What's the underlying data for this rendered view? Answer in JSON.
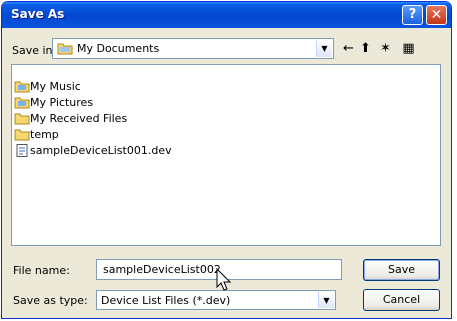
{
  "window": {
    "title": "Save As"
  },
  "title_buttons": {
    "help": "?",
    "close": "✕"
  },
  "save_in": {
    "label": "Save in:",
    "value": "My Documents",
    "folder_icon": "folder-icon"
  },
  "toolbar": [
    {
      "name": "back-icon",
      "glyph": "←"
    },
    {
      "name": "up-folder-icon",
      "glyph": "⬆"
    },
    {
      "name": "new-folder-icon",
      "glyph": "✶"
    },
    {
      "name": "view-menu-icon",
      "glyph": "▦"
    }
  ],
  "files": [
    {
      "label": "My Music",
      "kind": "special-folder",
      "icon": "music-folder-icon"
    },
    {
      "label": "My Pictures",
      "kind": "special-folder",
      "icon": "pictures-folder-icon"
    },
    {
      "label": "My Received Files",
      "kind": "folder",
      "icon": "folder-icon"
    },
    {
      "label": "temp",
      "kind": "folder",
      "icon": "folder-icon"
    },
    {
      "label": "sampleDeviceList001.dev",
      "kind": "file",
      "icon": "document-icon"
    }
  ],
  "file_name": {
    "label": "File name:",
    "value": "sampleDeviceList002"
  },
  "save_as_type": {
    "label": "Save as type:",
    "value": "Device List Files (*.dev)"
  },
  "buttons": {
    "save": "Save",
    "cancel": "Cancel"
  },
  "colors": {
    "titlebar": "#0a5ee6",
    "face": "#ece9d8",
    "border": "#7f9db9"
  }
}
